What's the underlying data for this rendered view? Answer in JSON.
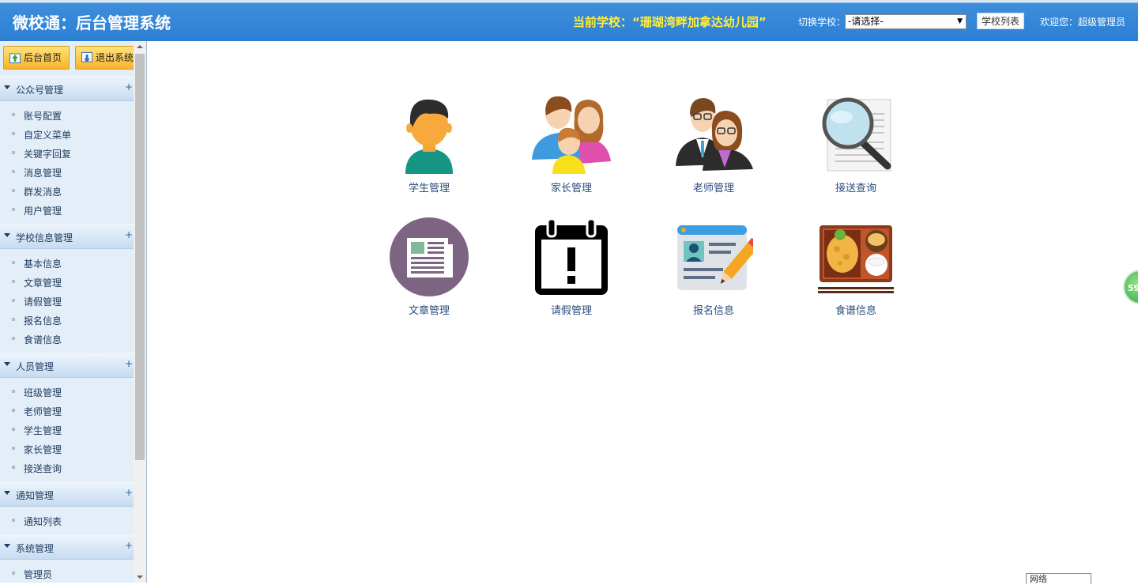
{
  "header": {
    "title": "微校通：后台管理系统",
    "current_school": "当前学校：“珊瑚湾畔加拿达幼儿园”",
    "switch_label": "切换学校：",
    "school_select_value": "-请选择-",
    "school_list_button": "学校列表",
    "welcome": "欢迎您：超级管理员"
  },
  "sidebar": {
    "home_button": "后台首页",
    "exit_button": "退出系统",
    "groups": [
      {
        "title": "公众号管理",
        "items": [
          "账号配置",
          "自定义菜单",
          "关键字回复",
          "消息管理",
          "群发消息",
          "用户管理"
        ]
      },
      {
        "title": "学校信息管理",
        "items": [
          "基本信息",
          "文章管理",
          "请假管理",
          "报名信息",
          "食谱信息"
        ]
      },
      {
        "title": "人员管理",
        "items": [
          "班级管理",
          "老师管理",
          "学生管理",
          "家长管理",
          "接送查询"
        ]
      },
      {
        "title": "通知管理",
        "items": [
          "通知列表"
        ]
      },
      {
        "title": "系统管理",
        "items": [
          "管理员"
        ]
      }
    ],
    "expand_symbol": "+"
  },
  "tiles": [
    {
      "label": "学生管理",
      "icon": "student-icon"
    },
    {
      "label": "家长管理",
      "icon": "parents-icon"
    },
    {
      "label": "老师管理",
      "icon": "teachers-icon"
    },
    {
      "label": "接送查询",
      "icon": "magnifier-document-icon"
    },
    {
      "label": "文章管理",
      "icon": "newspaper-icon"
    },
    {
      "label": "请假管理",
      "icon": "calendar-alert-icon"
    },
    {
      "label": "报名信息",
      "icon": "id-card-pencil-icon"
    },
    {
      "label": "食谱信息",
      "icon": "bento-meal-icon"
    }
  ],
  "overlays": {
    "bubble_text": "59",
    "network_box_text": "网络"
  },
  "colors": {
    "header_blue": "#2d7fd4",
    "school_yellow": "#ffee3a",
    "sidebar_bg": "#e3eef9",
    "tile_label": "#2c4d7d"
  }
}
